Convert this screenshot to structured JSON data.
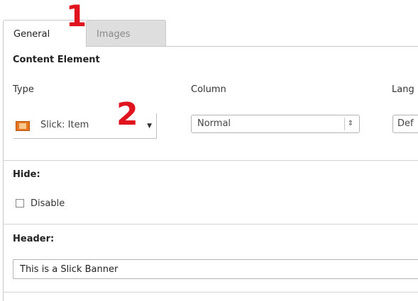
{
  "tabs": [
    {
      "label": "General",
      "active": true
    },
    {
      "label": "Images",
      "active": false
    }
  ],
  "annotations": {
    "marker1": "1",
    "marker2": "2",
    "color": "#e0141e"
  },
  "content_element": {
    "title": "Content Element",
    "type_label": "Type",
    "type_value": "Slick: Item",
    "type_icon": "slick-item-icon",
    "column_label": "Column",
    "column_value": "Normal",
    "language_label": "Lang",
    "language_value": "Def"
  },
  "hide": {
    "title": "Hide:",
    "disable_label": "Disable",
    "disable_checked": false
  },
  "header": {
    "title": "Header:",
    "value": "This is a Slick Banner"
  }
}
